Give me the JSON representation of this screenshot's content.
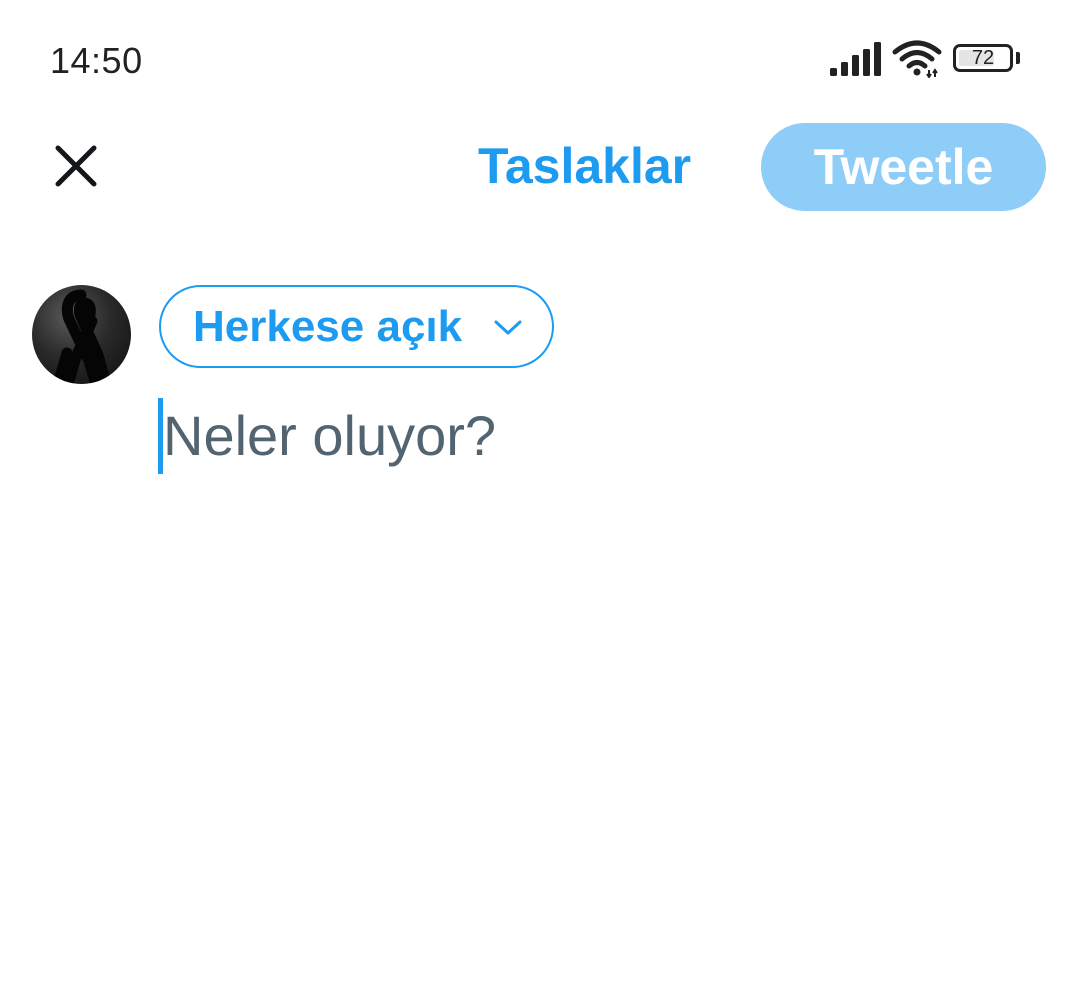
{
  "status_bar": {
    "time": "14:50",
    "battery_level": "72",
    "signal_icon": "cellular-signal-icon",
    "wifi_icon": "wifi-icon",
    "battery_icon": "battery-icon"
  },
  "toolbar": {
    "close_icon": "close-icon",
    "drafts_label": "Taslaklar",
    "tweet_label": "Tweetle"
  },
  "composer": {
    "audience_label": "Herkese açık",
    "audience_chevron_icon": "chevron-down-icon",
    "placeholder": "Neler oluyor?"
  },
  "colors": {
    "accent": "#1d9bf0",
    "tweet_button_disabled": "#8ecdf8",
    "placeholder_text": "#536471",
    "status_text": "#222222"
  }
}
